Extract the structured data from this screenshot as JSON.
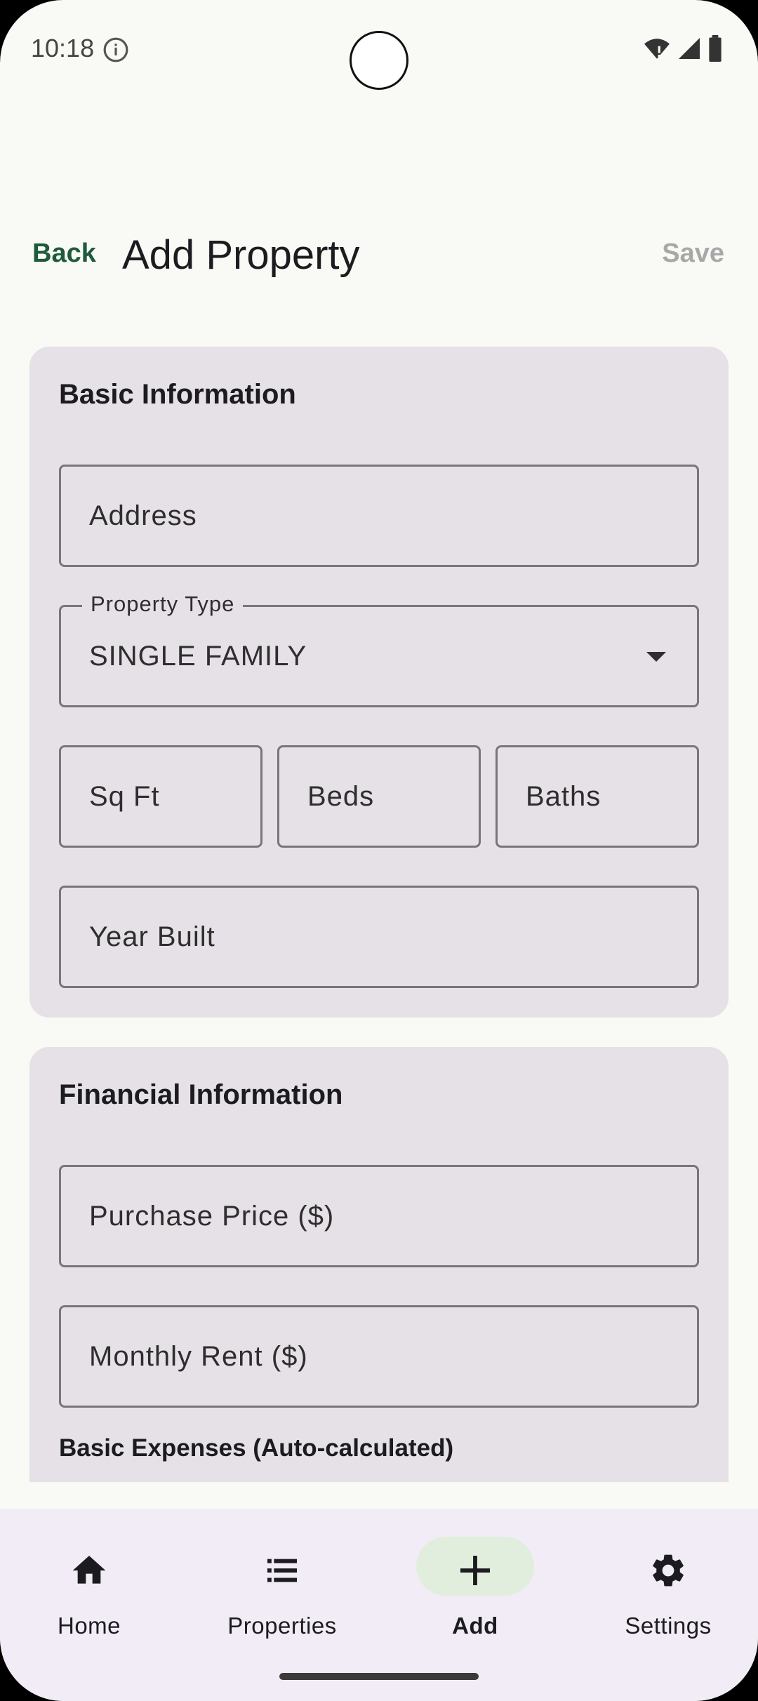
{
  "status_bar": {
    "time": "10:18"
  },
  "header": {
    "back_label": "Back",
    "title": "Add Property",
    "save_label": "Save"
  },
  "basic_info": {
    "title": "Basic Information",
    "address_placeholder": "Address",
    "property_type_label": "Property Type",
    "property_type_value": "SINGLE FAMILY",
    "sqft_placeholder": "Sq Ft",
    "beds_placeholder": "Beds",
    "baths_placeholder": "Baths",
    "year_built_placeholder": "Year Built"
  },
  "financial_info": {
    "title": "Financial Information",
    "purchase_price_placeholder": "Purchase Price ($)",
    "monthly_rent_placeholder": "Monthly Rent ($)",
    "expenses_heading": "Basic Expenses (Auto-calculated)"
  },
  "bottom_nav": {
    "items": [
      {
        "label": "Home",
        "icon": "home-icon"
      },
      {
        "label": "Properties",
        "icon": "list-icon"
      },
      {
        "label": "Add",
        "icon": "plus-icon",
        "active": true
      },
      {
        "label": "Settings",
        "icon": "gear-icon"
      }
    ]
  },
  "colors": {
    "accent": "#1e5a3b",
    "card_background": "#e6e1e6",
    "nav_background": "#f1ecf5",
    "active_pill": "#e1eedd"
  }
}
